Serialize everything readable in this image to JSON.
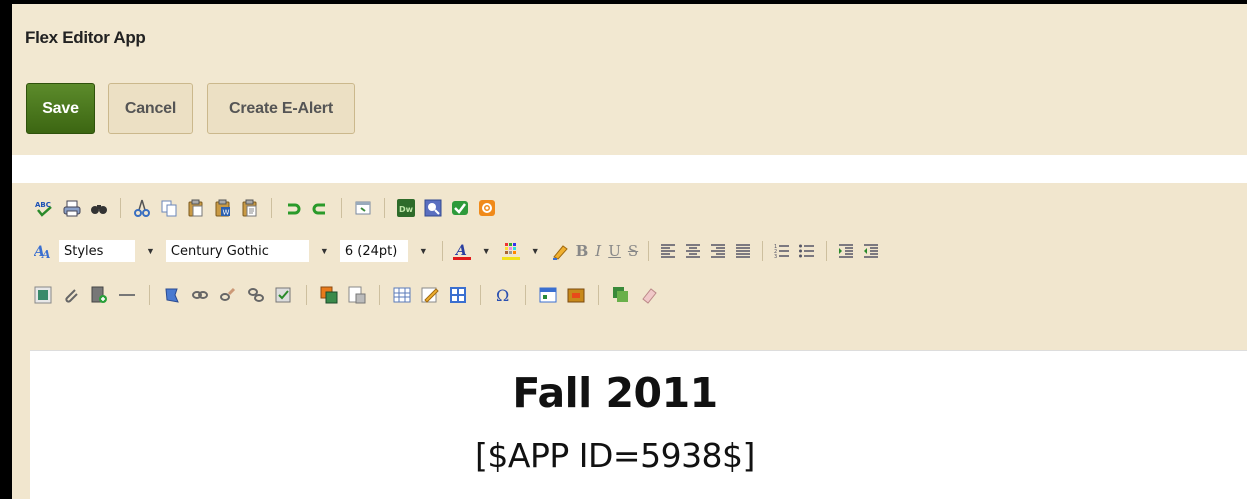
{
  "app": {
    "title": "Flex Editor App"
  },
  "actions": {
    "save_label": "Save",
    "cancel_label": "Cancel",
    "alert_label": "Create E-Alert"
  },
  "toolbar": {
    "style_value": "Styles",
    "font_value": "Century Gothic",
    "size_value": "6 (24pt)",
    "dw_label": "Dw",
    "bold": "B",
    "italic": "I",
    "underline": "U",
    "strike": "S",
    "omega": "Ω"
  },
  "document": {
    "heading": "Fall 2011",
    "app_id": "[$APP ID=5938$]"
  },
  "colors": {
    "save_green": "#4a7a1e",
    "panel": "#f2e8d1"
  }
}
